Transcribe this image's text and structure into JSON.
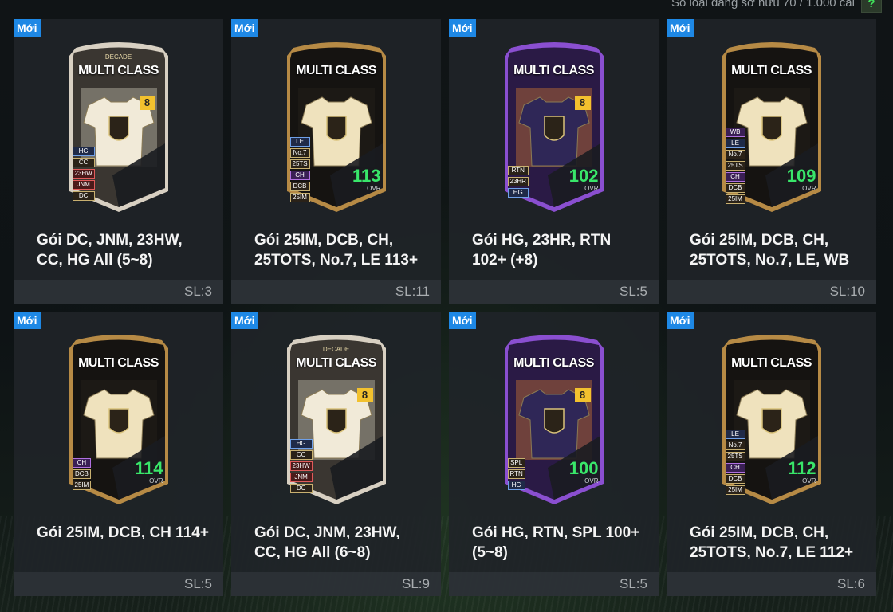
{
  "header": {
    "owned_text": "Số loại đang sở hữu 70 / 1.000 cái",
    "help_label": "?"
  },
  "new_label": "Mới",
  "cards": [
    {
      "title": "Gói DC, JNM, 23HW, CC, HG All (5~8)",
      "qty": "SL:3",
      "card_name": "MULTI CLASS",
      "subtitle": "DECADE",
      "style": "silver",
      "level": "8",
      "tags": [
        "HG",
        "CC",
        "23HW",
        "JNM",
        "DC"
      ],
      "ovr": "",
      "ovr_label": ""
    },
    {
      "title": "Gói 25IM, DCB, CH, 25TOTS, No.7, LE 113+",
      "qty": "SL:11",
      "card_name": "MULTI CLASS",
      "subtitle": "",
      "style": "gold",
      "level": "",
      "tags": [
        "LE",
        "No.7",
        "25TS",
        "CH",
        "DCB",
        "25IM"
      ],
      "ovr": "113",
      "ovr_label": "OVR"
    },
    {
      "title": "Gói HG, 23HR, RTN 102+ (+8)",
      "qty": "SL:5",
      "card_name": "MULTI CLASS",
      "subtitle": "",
      "style": "purple",
      "level": "8",
      "tags": [
        "RTN",
        "23HR",
        "HG"
      ],
      "ovr": "102",
      "ovr_label": "OVR"
    },
    {
      "title": "Gói 25IM, DCB, CH, 25TOTS, No.7, LE, WB",
      "qty": "SL:10",
      "card_name": "MULTI CLASS",
      "subtitle": "",
      "style": "gold",
      "level": "",
      "tags": [
        "WB",
        "LE",
        "No.7",
        "25TS",
        "CH",
        "DCB",
        "25IM"
      ],
      "ovr": "109",
      "ovr_label": "OVR"
    },
    {
      "title": "Gói 25IM, DCB, CH 114+",
      "qty": "SL:5",
      "card_name": "MULTI CLASS",
      "subtitle": "",
      "style": "gold",
      "level": "",
      "tags": [
        "CH",
        "DCB",
        "25IM"
      ],
      "ovr": "114",
      "ovr_label": "OVR"
    },
    {
      "title": "Gói DC, JNM, 23HW, CC, HG All (6~8)",
      "qty": "SL:9",
      "card_name": "MULTI CLASS",
      "subtitle": "DECADE",
      "style": "silver",
      "level": "8",
      "tags": [
        "HG",
        "CC",
        "23HW",
        "JNM",
        "DC"
      ],
      "ovr": "",
      "ovr_label": ""
    },
    {
      "title": "Gói HG, RTN, SPL 100+ (5~8)",
      "qty": "SL:5",
      "card_name": "MULTI CLASS",
      "subtitle": "",
      "style": "purple",
      "level": "8",
      "tags": [
        "SPL",
        "RTN",
        "HG"
      ],
      "ovr": "100",
      "ovr_label": "OVR"
    },
    {
      "title": "Gói 25IM, DCB, CH, 25TOTS, No.7, LE 112+",
      "qty": "SL:6",
      "card_name": "MULTI CLASS",
      "subtitle": "",
      "style": "gold",
      "level": "",
      "tags": [
        "LE",
        "No.7",
        "25TS",
        "CH",
        "DCB",
        "25IM"
      ],
      "ovr": "112",
      "ovr_label": "OVR"
    }
  ]
}
